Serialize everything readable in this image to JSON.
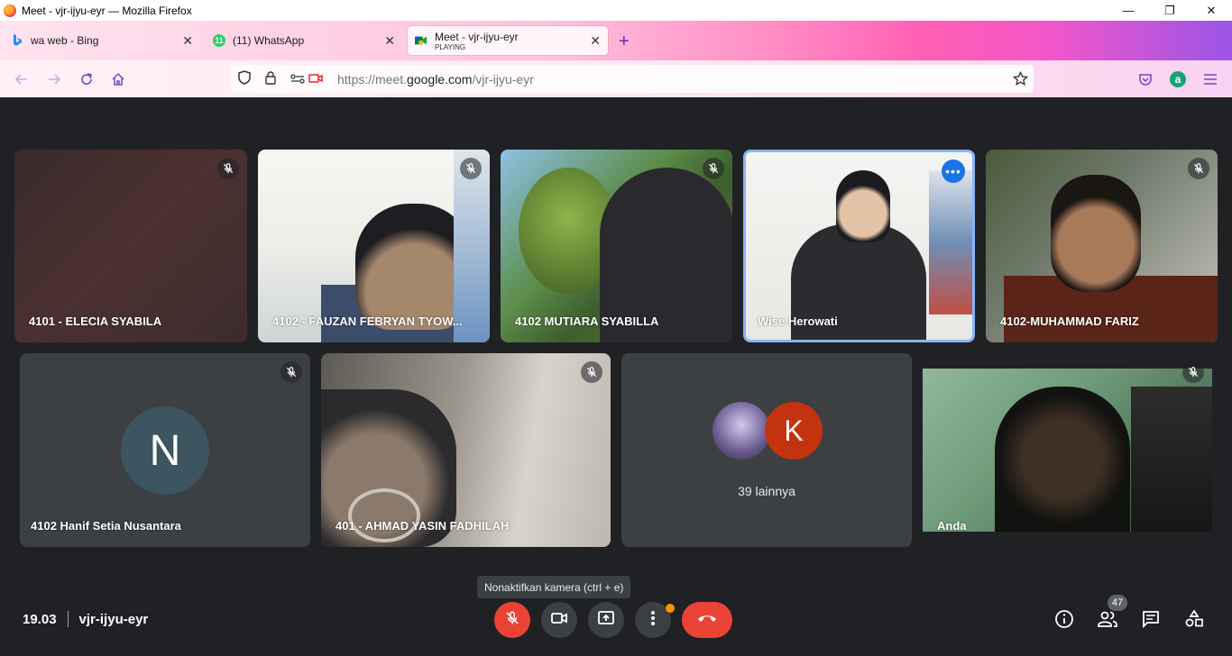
{
  "window": {
    "title": "Meet - vjr-ijyu-eyr — Mozilla Firefox",
    "minimize": "—",
    "maximize": "❐",
    "close": "✕"
  },
  "tabs": [
    {
      "label": "wa web - Bing",
      "icon": "bing-icon"
    },
    {
      "label": "(11) WhatsApp",
      "icon": "whatsapp-icon",
      "badge": "11"
    },
    {
      "label": "Meet - vjr-ijyu-eyr",
      "sub": "PLAYING",
      "icon": "meet-icon",
      "active": true
    }
  ],
  "tab_close": "✕",
  "new_tab": "+",
  "url": {
    "prefix": "https://meet.",
    "host": "google.com",
    "path": "/vjr-ijyu-eyr"
  },
  "participants": [
    {
      "name": "4101 - ELECIA SYABILA",
      "muted": true
    },
    {
      "name": "4102 - FAUZAN FEBRYAN TYOW...",
      "muted": true
    },
    {
      "name": "4102 MUTIARA SYABILLA",
      "muted": true
    },
    {
      "name": "Wise Herowati",
      "muted": false,
      "speaking": true
    },
    {
      "name": "4102-MUHAMMAD FARIZ",
      "muted": true
    },
    {
      "name": "4102 Hanif Setia Nusantara",
      "muted": true,
      "avatar_letter": "N"
    },
    {
      "name": "401 - AHMAD YASIN FADHILAH",
      "muted": true
    },
    {
      "name": "Anda",
      "muted": true
    }
  ],
  "others": {
    "avatar_letter": "K",
    "label": "39 lainnya"
  },
  "bottom": {
    "time": "19.03",
    "meeting_code": "vjr-ijyu-eyr",
    "tooltip": "Nonaktifkan kamera (ctrl + e)",
    "people_count": "47"
  },
  "colors": {
    "meet_bg": "#202124",
    "tile_bg": "#3c4043",
    "end_call": "#ea4335",
    "active_speaker": "#8ab4f8",
    "avatar_k": "#c4330f",
    "avatar_n": "#3c5561"
  }
}
